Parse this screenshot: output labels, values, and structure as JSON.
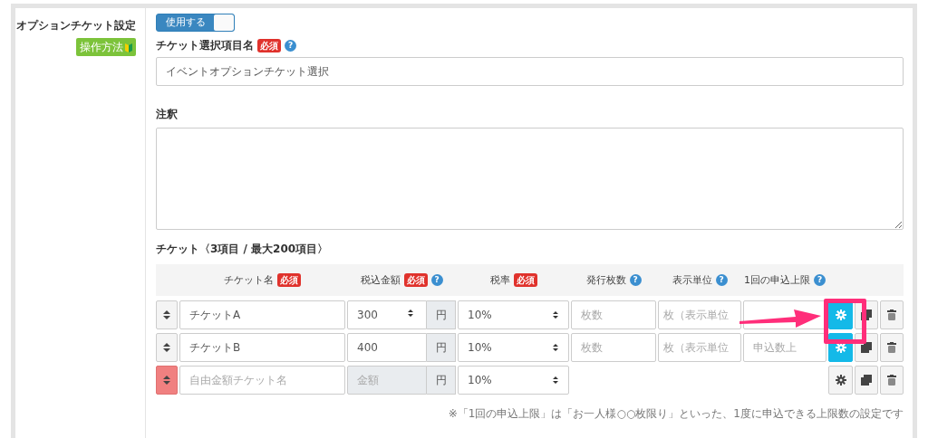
{
  "setting": {
    "label": "オプションチケット設定",
    "guide_badge": "操作方法"
  },
  "toggle": {
    "label": "使用する",
    "on": true
  },
  "item_name": {
    "label": "チケット選択項目名",
    "required": "必須",
    "help": "?",
    "value": "イベントオプションチケット選択"
  },
  "note": {
    "label": "注釈"
  },
  "tickets": {
    "heading": "チケット〈3項目 / 最大200項目〉",
    "columns": [
      {
        "label": "チケット名",
        "required": "必須"
      },
      {
        "label": "税込金額",
        "required": "必須",
        "help": "?"
      },
      {
        "label": "税率",
        "required": "必須"
      },
      {
        "label": "発行枚数",
        "help": "?"
      },
      {
        "label": "表示単位",
        "help": "?"
      },
      {
        "label": "1回の申込上限",
        "help": "?"
      }
    ],
    "rows": [
      {
        "kind": "fixed",
        "name": "チケットA",
        "price": "300",
        "spinner": true,
        "currency": "円",
        "tax": "10%",
        "count_placeholder": "枚数",
        "unit_placeholder": "枚（表示単位",
        "highlighted": true
      },
      {
        "kind": "fixed",
        "name": "チケットB",
        "price": "400",
        "spinner": false,
        "currency": "円",
        "tax": "10%",
        "count_placeholder": "枚数",
        "unit_placeholder": "枚（表示単位",
        "limit_placeholder": "申込数上",
        "highlighted": false
      },
      {
        "kind": "free",
        "name_placeholder": "自由金額チケット名",
        "price_placeholder": "金額",
        "currency": "円",
        "tax": "10%",
        "highlighted": false
      }
    ],
    "footnote": "※「1回の申込上限」は「お一人様○○枚限り」といった、1度に申込できる上限数の設定です"
  }
}
